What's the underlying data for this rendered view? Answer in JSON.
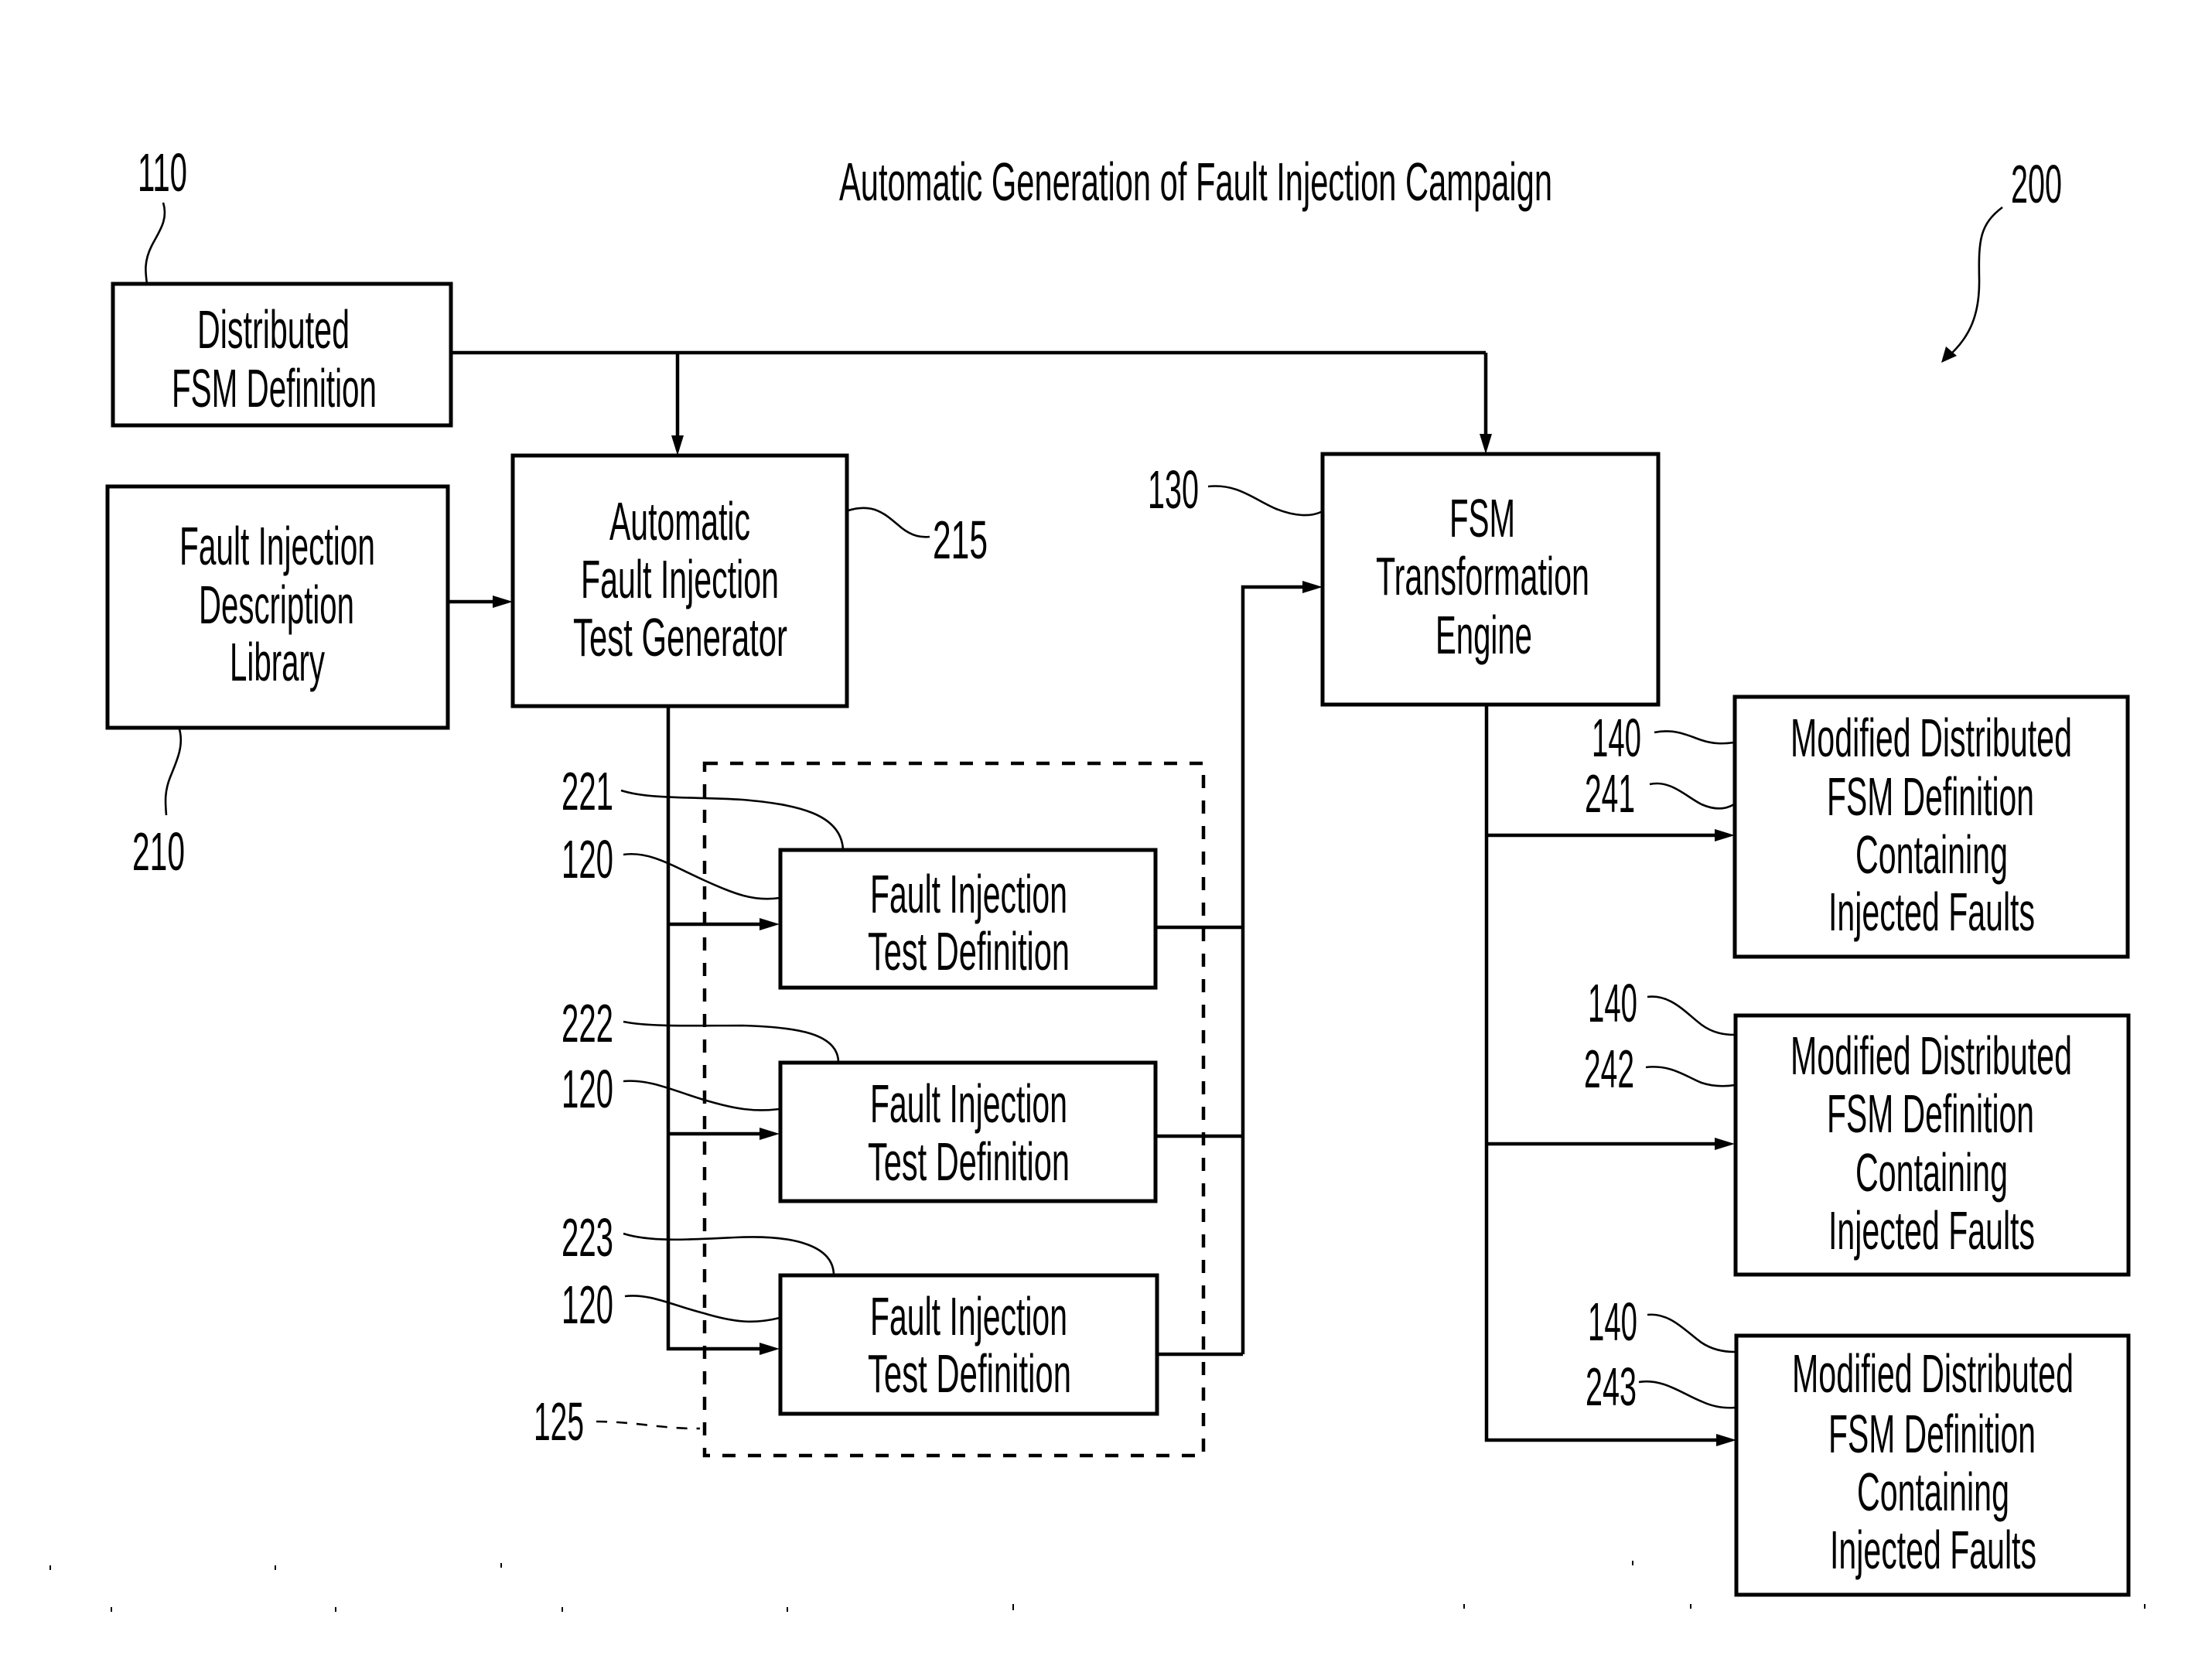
{
  "figure": {
    "title": "Automatic Generation of Fault Injection Campaign",
    "figure_ref": "200"
  },
  "boxes": {
    "distributed_fsm": {
      "ref": "110",
      "lines": [
        "Distributed",
        "FSM Definition"
      ]
    },
    "fault_library": {
      "ref": "210",
      "lines": [
        "Fault Injection",
        "Description",
        "Library"
      ]
    },
    "test_generator": {
      "ref": "215",
      "lines": [
        "Automatic",
        "Fault Injection",
        "Test Generator"
      ]
    },
    "transformation_engine": {
      "ref": "130",
      "lines": [
        "FSM",
        "Transformation",
        "Engine"
      ]
    },
    "test_definitions": [
      {
        "ref_a": "221",
        "ref_b": "120",
        "lines": [
          "Fault Injection",
          "Test Definition"
        ]
      },
      {
        "ref_a": "222",
        "ref_b": "120",
        "lines": [
          "Fault Injection",
          "Test Definition"
        ]
      },
      {
        "ref_a": "223",
        "ref_b": "120",
        "lines": [
          "Fault Injection",
          "Test Definition"
        ]
      }
    ],
    "campaign_group_ref": "125",
    "modified_definitions": [
      {
        "ref_a": "140",
        "ref_b": "241",
        "lines": [
          "Modified Distributed",
          "FSM Definition",
          "Containing",
          "Injected Faults"
        ]
      },
      {
        "ref_a": "140",
        "ref_b": "242",
        "lines": [
          "Modified Distributed",
          "FSM Definition",
          "Containing",
          "Injected Faults"
        ]
      },
      {
        "ref_a": "140",
        "ref_b": "243",
        "lines": [
          "Modified Distributed",
          "FSM Definition",
          "Containing",
          "Injected Faults"
        ]
      }
    ]
  },
  "colors": {
    "ink": "#000000",
    "paper": "#ffffff"
  }
}
